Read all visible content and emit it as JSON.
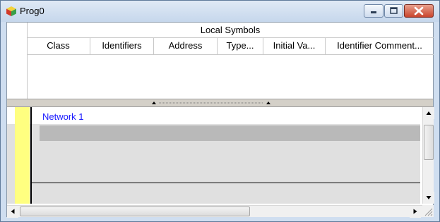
{
  "window": {
    "title": "Prog0",
    "icons": {
      "app": "cube-icon",
      "minimize": "minimize-icon",
      "maximize": "maximize-icon",
      "close": "close-icon"
    }
  },
  "symbols": {
    "section_title": "Local Symbols",
    "columns": [
      "Class",
      "Identifiers",
      "Address",
      "Type...",
      "Initial Va...",
      "Identifier Comment..."
    ]
  },
  "splitter": {
    "icons": [
      "chevron-up-icon",
      "chevron-up-icon"
    ]
  },
  "editor": {
    "network_label": "Network 1"
  },
  "scrollbars": {
    "icons": [
      "arrow-up-icon",
      "arrow-down-icon",
      "arrow-left-icon",
      "arrow-right-icon",
      "size-grip-icon"
    ]
  },
  "colors": {
    "power_rail_bar": "#ffff80",
    "network_label": "#1a1aff",
    "close_button": "#c9452d"
  }
}
